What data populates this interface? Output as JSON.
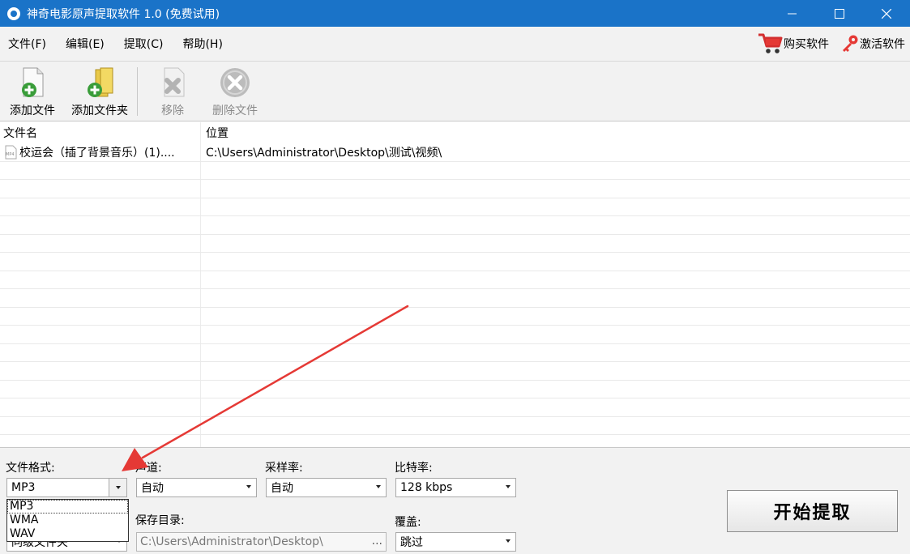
{
  "window": {
    "title": "神奇电影原声提取软件 1.0 (免费试用)"
  },
  "menu": {
    "items": [
      "文件(F)",
      "编辑(E)",
      "提取(C)",
      "帮助(H)"
    ],
    "buy_label": "购买软件",
    "activate_label": "激活软件"
  },
  "toolbar": {
    "add_file": "添加文件",
    "add_folder": "添加文件夹",
    "remove": "移除",
    "delete_file": "删除文件"
  },
  "list": {
    "col_name": "文件名",
    "col_path": "位置",
    "rows": [
      {
        "icon_text": "MP4",
        "name": "校运会（插了背景音乐）(1)....",
        "path": "C:\\Users\\Administrator\\Desktop\\测试\\视频\\"
      }
    ]
  },
  "settings": {
    "format_label": "文件格式:",
    "format_value": "MP3",
    "channel_label": "声道:",
    "channel_value": "自动",
    "samplerate_label": "采样率:",
    "samplerate_value": "自动",
    "bitrate_label": "比特率:",
    "bitrate_value": "128 kbps",
    "savedir_label": "保存目录:",
    "savedir_value": "C:\\Users\\Administrator\\Desktop\\",
    "browse_label": "...",
    "output_location_value": "同级文件夹",
    "overwrite_label": "覆盖:",
    "overwrite_value": "跳过",
    "format_options": [
      "MP3",
      "WMA",
      "WAV"
    ]
  },
  "start_button": "开始提取",
  "colors": {
    "titlebar": "#1a73c8",
    "annotation_arrow": "#e53935"
  }
}
